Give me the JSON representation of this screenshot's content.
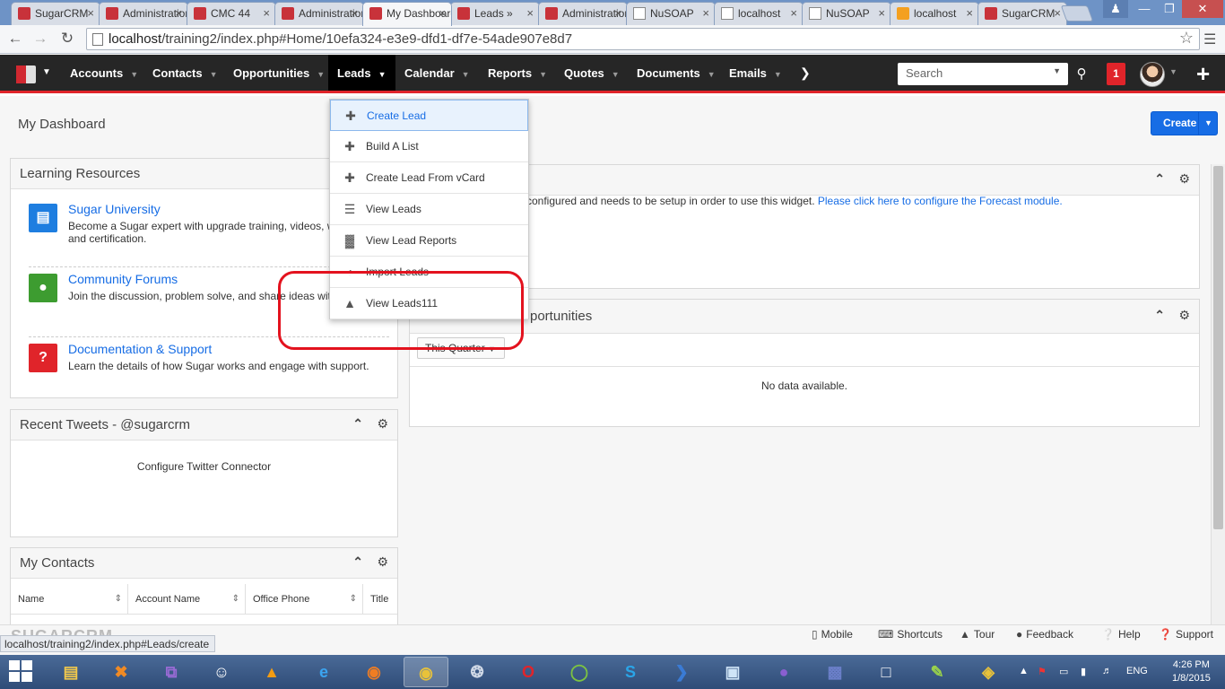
{
  "browser": {
    "tabs": [
      {
        "title": "SugarCRM",
        "icon": "sugar"
      },
      {
        "title": "Administration",
        "icon": "sugar"
      },
      {
        "title": "CMC 44",
        "icon": "sugar"
      },
      {
        "title": "Administration",
        "icon": "sugar"
      },
      {
        "title": "My Dashboard",
        "icon": "sugar",
        "active": true
      },
      {
        "title": "Leads » ",
        "icon": "sugar"
      },
      {
        "title": "Administration",
        "icon": "sugar"
      },
      {
        "title": "NuSOAP",
        "icon": "page"
      },
      {
        "title": "localhost",
        "icon": "page"
      },
      {
        "title": "NuSOAP",
        "icon": "page"
      },
      {
        "title": "localhost",
        "icon": "pma"
      },
      {
        "title": "SugarCRM",
        "icon": "sugar"
      }
    ],
    "url_host": "localhost",
    "url_path": "/training2/index.php#Home/10efa324-e3e9-dfd1-df7e-54ade907e8d7"
  },
  "nav": {
    "items": [
      {
        "label": "Accounts"
      },
      {
        "label": "Contacts"
      },
      {
        "label": "Opportunities"
      },
      {
        "label": "Leads",
        "active": true
      },
      {
        "label": "Calendar"
      },
      {
        "label": "Reports"
      },
      {
        "label": "Quotes"
      },
      {
        "label": "Documents"
      },
      {
        "label": "Emails"
      }
    ],
    "search_placeholder": "Search",
    "notification_count": "1"
  },
  "page": {
    "title": "My Dashboard",
    "create_label": "Create"
  },
  "leads_menu": [
    {
      "label": "Create Lead",
      "icon": "plus-icon"
    },
    {
      "label": "Build A List",
      "icon": "plus-icon"
    },
    {
      "label": "Create Lead From vCard",
      "icon": "plus-icon"
    },
    {
      "label": "View Leads",
      "icon": "list-icon"
    },
    {
      "label": "View Lead Reports",
      "icon": "bar-chart-icon"
    },
    {
      "label": "Import Leads",
      "icon": "import-icon"
    },
    {
      "label": "View Leads111",
      "icon": "user-icon"
    }
  ],
  "learning": {
    "title": "Learning Resources",
    "items": [
      {
        "title": "Sugar University",
        "desc": "Become a Sugar expert with upgrade training, videos, webinars, and certification.",
        "color": "#1e7ee0"
      },
      {
        "title": "Community Forums",
        "desc": "Join the discussion, problem solve, and share ideas with users.",
        "color": "#3d9c30"
      },
      {
        "title": "Documentation & Support",
        "desc": "Learn the details of how Sugar works and engage with support.",
        "color": "#e0242a"
      }
    ]
  },
  "tweets": {
    "title": "Recent Tweets - @sugarcrm",
    "body": "Configure Twitter Connector"
  },
  "contacts": {
    "title": "My Contacts",
    "columns": [
      "Name",
      "Account Name",
      "Office Phone",
      "Title"
    ]
  },
  "forecast": {
    "text": "configured and needs to be setup in order to use this widget.",
    "link": "Please click here to configure the Forecast module."
  },
  "opportunities": {
    "title_fragment": "portunities",
    "filter": "This Quarter",
    "empty": "No data available."
  },
  "footer": {
    "logo": "SUGARCRM",
    "links": [
      "Mobile",
      "Shortcuts",
      "Tour",
      "Feedback",
      "Help",
      "Support"
    ],
    "status_url": "localhost/training2/index.php#Leads/create"
  },
  "taskbar": {
    "lang": "ENG",
    "time": "4:26 PM",
    "date": "1/8/2015"
  },
  "colors": {
    "accent": "#e0242a",
    "primary": "#176de5",
    "nav_bg": "#262626"
  }
}
